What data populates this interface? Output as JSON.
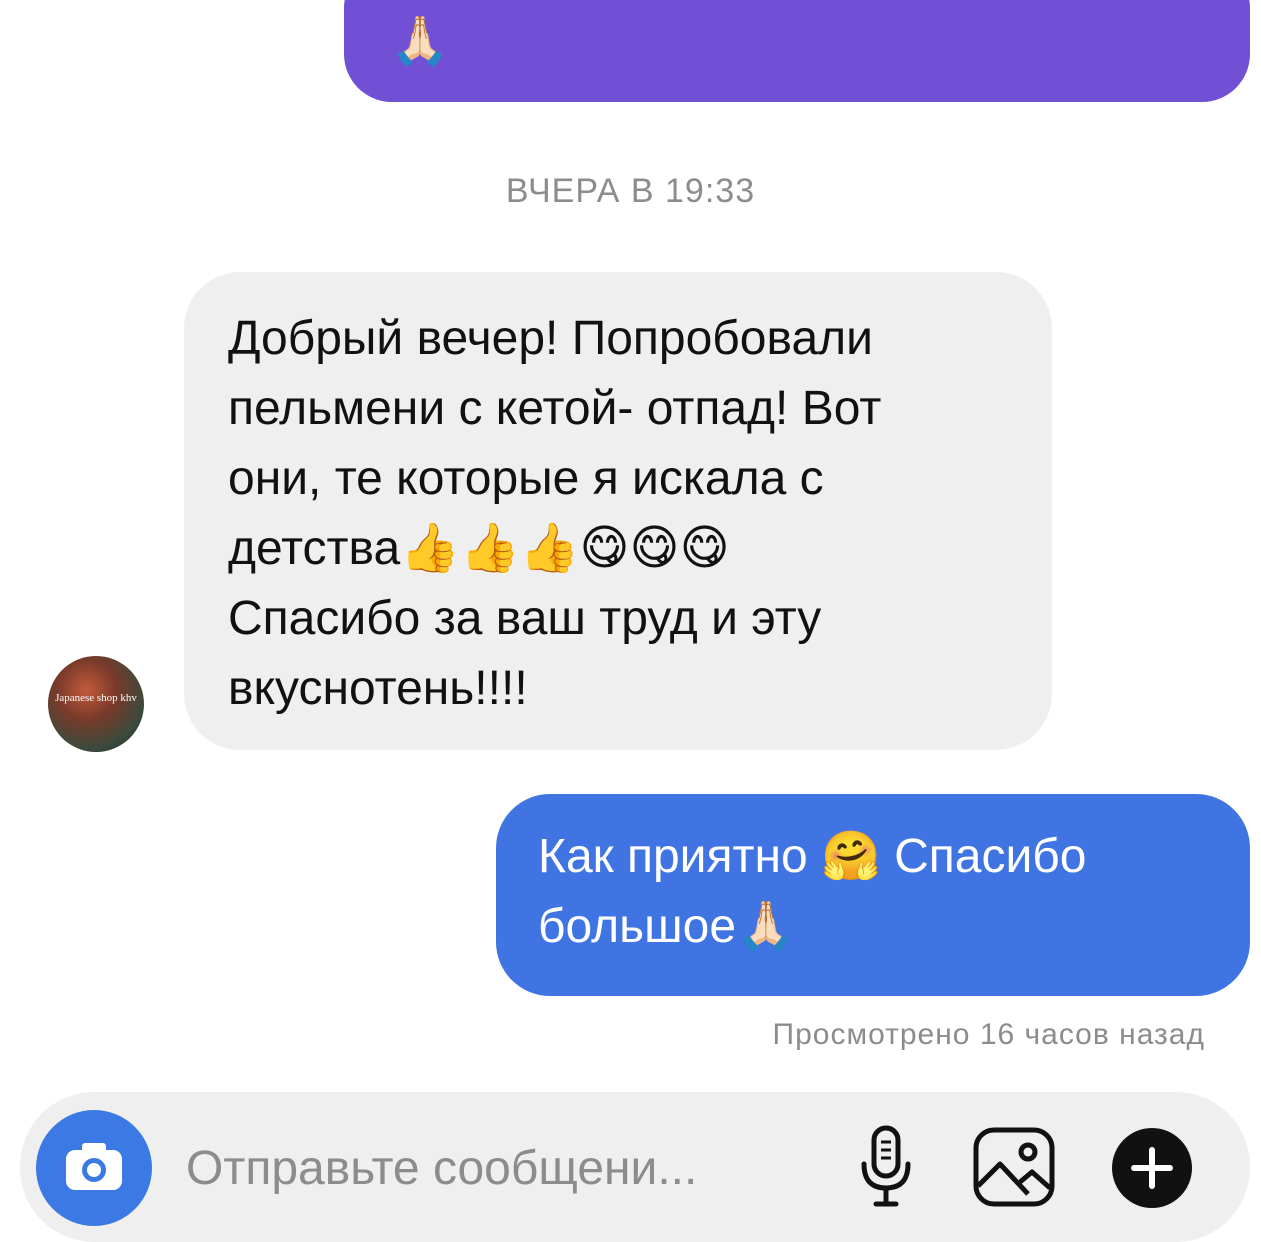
{
  "conversation": {
    "top_message_emoji": "🙏🏻",
    "timestamp": "ВЧЕРА В 19:33",
    "received_message": {
      "lines": [
        "Добрый вечер! Попробовали",
        "пельмени с кетой- отпад! Вот",
        "они, те которые я искала с",
        "детства👍👍👍😋😋😋",
        "Спасибо за ваш труд и эту",
        "вкуснотень!!!!"
      ],
      "avatar_text": "Japanese shop khv"
    },
    "sent_message": {
      "lines": [
        "Как приятно 🤗 Спасибо",
        "большое🙏🏻"
      ]
    },
    "seen_status": "Просмотрено 16 часов назад"
  },
  "composer": {
    "placeholder": "Отправьте сообщени...",
    "icons": [
      "camera-icon",
      "microphone-icon",
      "gallery-icon",
      "plus-icon"
    ]
  },
  "colors": {
    "sent_bubble": "#3f74e2",
    "top_bubble": "#7150d6",
    "received_bubble": "#efefef",
    "camera_button": "#3b7ae4",
    "meta_text": "#8c8c8c"
  }
}
